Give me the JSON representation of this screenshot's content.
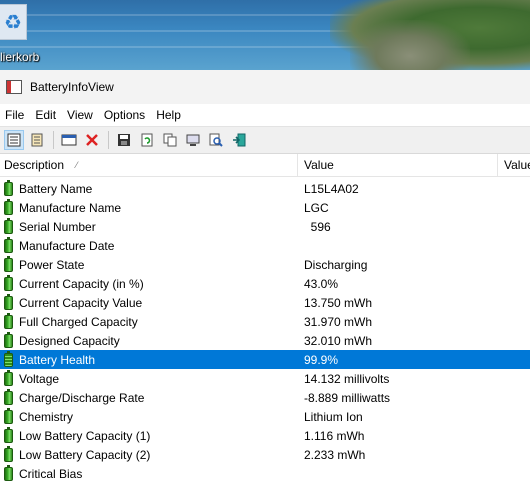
{
  "desktop": {
    "icon_label": "lierkorb"
  },
  "window": {
    "title": "BatteryInfoView"
  },
  "menu": [
    "File",
    "Edit",
    "View",
    "Options",
    "Help"
  ],
  "toolbar": {
    "icons": [
      "details-view-icon",
      "html-report-icon",
      "properties-icon",
      "delete-icon",
      "save-icon",
      "refresh-icon",
      "copy-icon",
      "computer-properties-icon",
      "find-icon",
      "exit-icon"
    ]
  },
  "columns": {
    "description": "Description",
    "value": "Value",
    "value2": "Value"
  },
  "rows": [
    {
      "label": "Battery Name",
      "value": "L15L4A02"
    },
    {
      "label": "Manufacture Name",
      "value": "LGC"
    },
    {
      "label": "Serial Number",
      "value": "  596"
    },
    {
      "label": "Manufacture Date",
      "value": ""
    },
    {
      "label": "Power State",
      "value": "Discharging"
    },
    {
      "label": "Current Capacity (in %)",
      "value": "43.0%"
    },
    {
      "label": "Current Capacity Value",
      "value": "13.750 mWh"
    },
    {
      "label": "Full Charged Capacity",
      "value": "31.970 mWh"
    },
    {
      "label": "Designed Capacity",
      "value": "32.010 mWh"
    },
    {
      "label": "Battery Health",
      "value": "99.9%"
    },
    {
      "label": "Voltage",
      "value": "14.132 millivolts"
    },
    {
      "label": "Charge/Discharge Rate",
      "value": "-8.889 milliwatts"
    },
    {
      "label": "Chemistry",
      "value": "Lithium Ion"
    },
    {
      "label": "Low Battery Capacity (1)",
      "value": "1.116 mWh"
    },
    {
      "label": "Low Battery Capacity (2)",
      "value": "2.233 mWh"
    },
    {
      "label": "Critical Bias",
      "value": ""
    }
  ],
  "selected_row": 9,
  "colors": {
    "selection": "#0078d7"
  }
}
